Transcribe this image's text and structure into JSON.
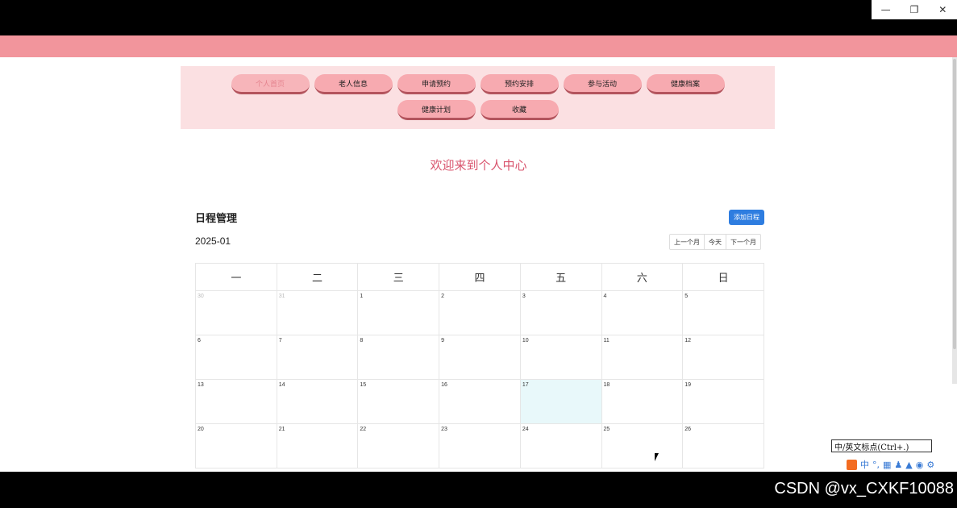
{
  "window": {
    "minimize_icon": "minimize-icon",
    "restore_icon": "restore-icon",
    "close_icon": "close-icon"
  },
  "nav": {
    "items": [
      {
        "label": "个人首页",
        "active": true
      },
      {
        "label": "老人信息",
        "active": false
      },
      {
        "label": "申请预约",
        "active": false
      },
      {
        "label": "预约安排",
        "active": false
      },
      {
        "label": "参与活动",
        "active": false
      },
      {
        "label": "健康档案",
        "active": false
      },
      {
        "label": "健康计划",
        "active": false
      },
      {
        "label": "收藏",
        "active": false
      }
    ]
  },
  "welcome": "欢迎来到个人中心",
  "schedule": {
    "title": "日程管理",
    "add_button": "添加日程",
    "month": "2025-01",
    "prev": "上一个月",
    "today": "今天",
    "next": "下一个月",
    "weekdays": [
      "一",
      "二",
      "三",
      "四",
      "五",
      "六",
      "日"
    ],
    "weeks": [
      [
        "30",
        "31",
        "1",
        "2",
        "3",
        "4",
        "5"
      ],
      [
        "6",
        "7",
        "8",
        "9",
        "10",
        "11",
        "12"
      ],
      [
        "13",
        "14",
        "15",
        "16",
        "17",
        "18",
        "19"
      ],
      [
        "20",
        "21",
        "22",
        "23",
        "24",
        "25",
        "26"
      ]
    ],
    "today_date": "17"
  },
  "ime": {
    "tooltip": "中/英文标点(Ctrl+.)",
    "mode": "中"
  },
  "watermark": "CSDN @vx_CXKF10088",
  "colors": {
    "header_pink": "#f2959c",
    "nav_bg": "#fbe0e2",
    "nav_button": "#f7aab0",
    "welcome_text": "#d9556e",
    "primary_button": "#2e7de0",
    "today_bg": "#e8f8fa"
  }
}
